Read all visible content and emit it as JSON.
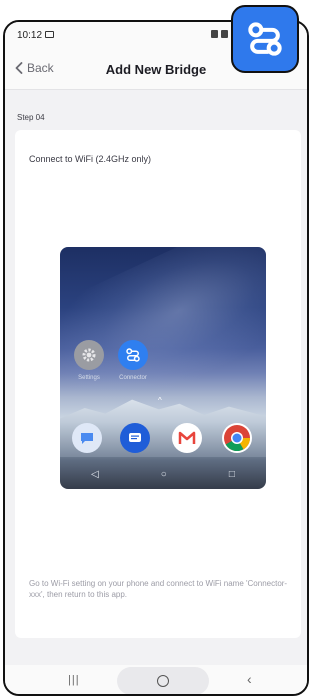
{
  "status_bar": {
    "time": "10:12"
  },
  "header": {
    "back_label": "Back",
    "title": "Add New Bridge"
  },
  "step": {
    "label": "Step 04"
  },
  "card": {
    "title": "Connect to WiFi (2.4GHz only)",
    "footer": "Go to Wi-Fi setting on your phone and connect to WiFi name 'Connector-xxx', then return to this app."
  },
  "preview": {
    "apps": [
      {
        "label": "Settings"
      },
      {
        "label": "Connector"
      }
    ],
    "dock": [
      "chat-icon",
      "messages-icon",
      "gmail-icon",
      "chrome-icon"
    ]
  },
  "colors": {
    "accent": "#2f79ec",
    "connector_blue": "#2f7ff0"
  }
}
